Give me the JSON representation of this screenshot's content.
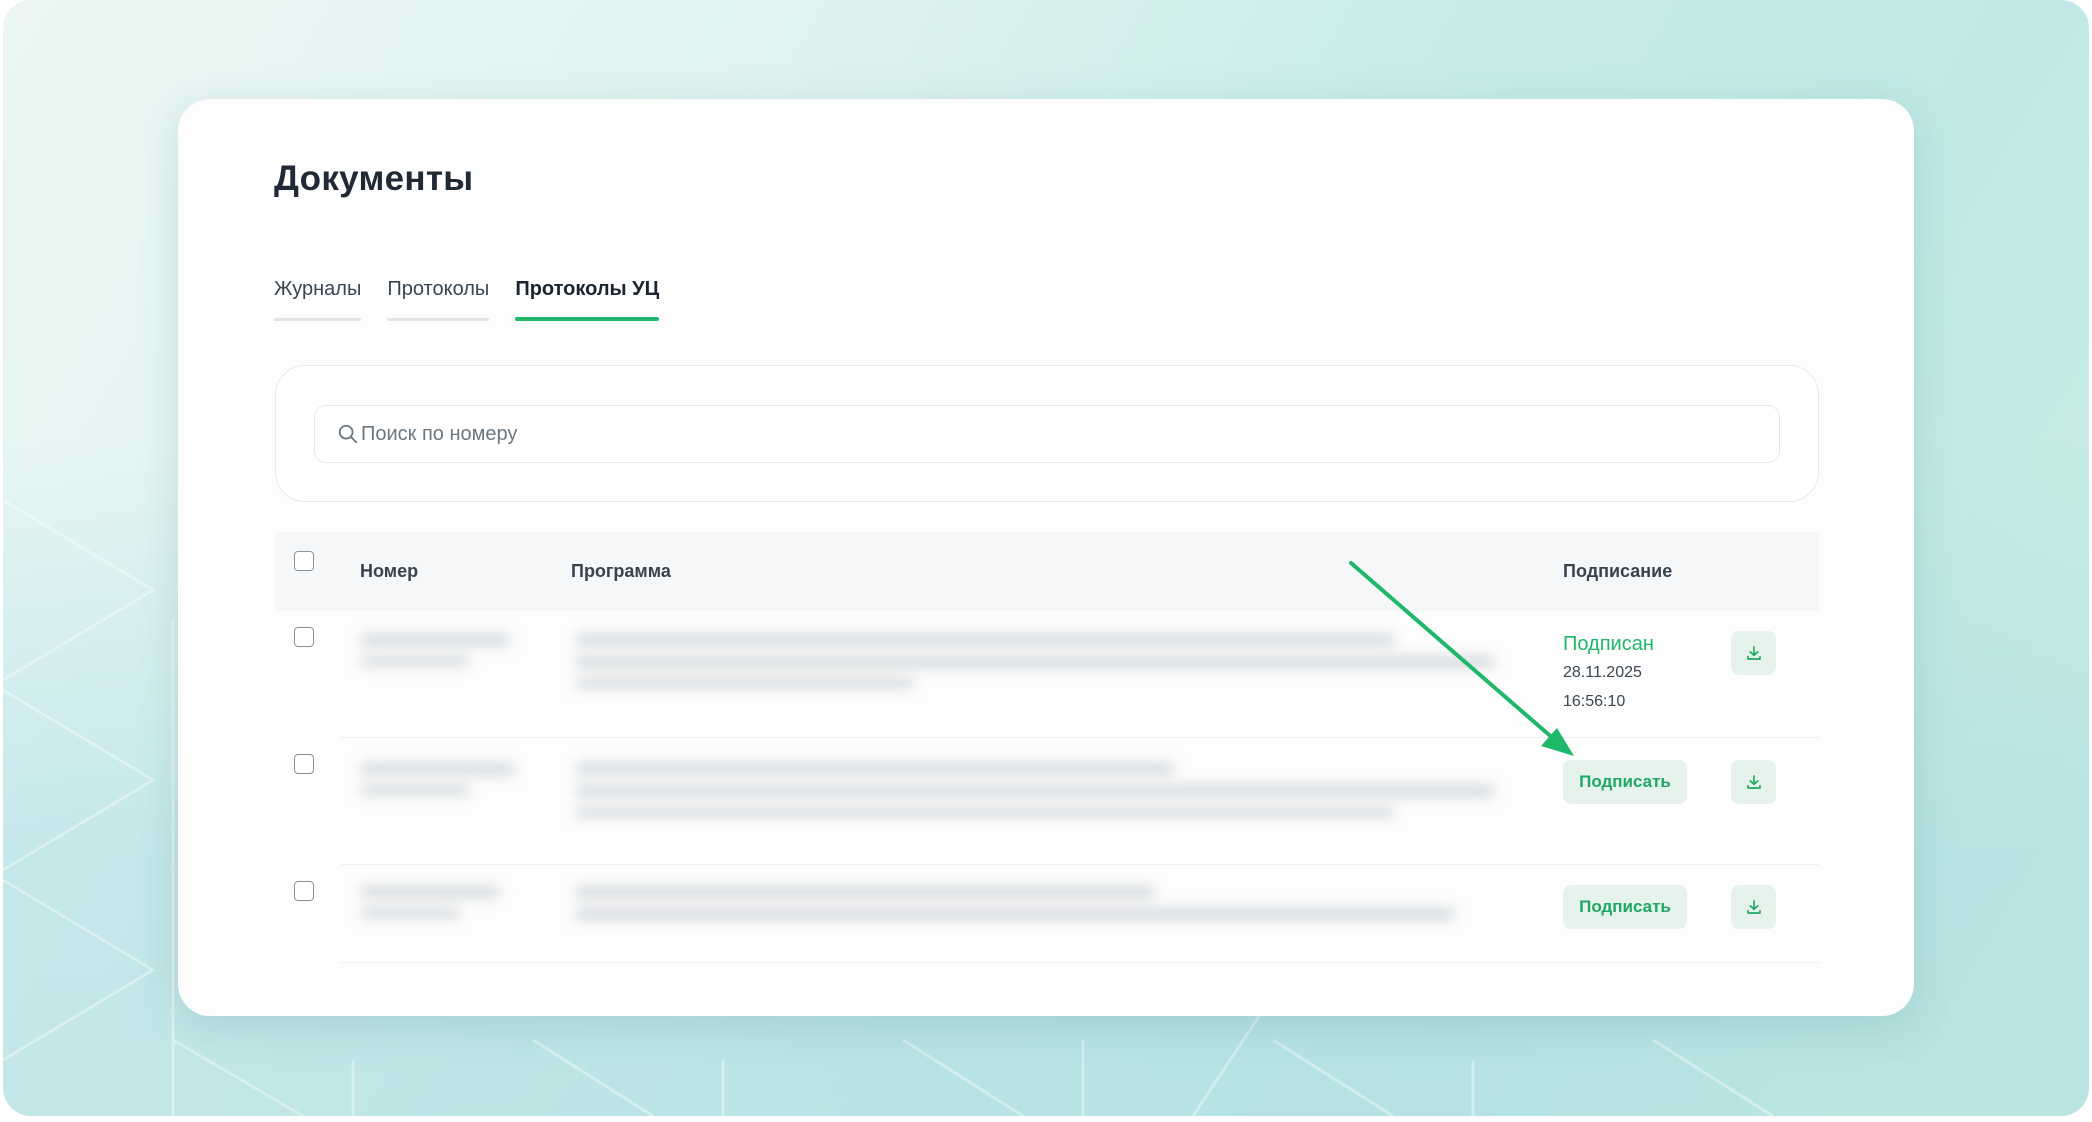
{
  "page_title": "Документы",
  "tabs": [
    {
      "label": "Журналы",
      "active": false
    },
    {
      "label": "Протоколы",
      "active": false
    },
    {
      "label": "Протоколы УЦ",
      "active": true
    }
  ],
  "search": {
    "placeholder": "Поиск по номеру",
    "value": ""
  },
  "table": {
    "columns": {
      "number": "Номер",
      "program": "Программа",
      "signing": "Подписание"
    },
    "rows": [
      {
        "status": "Подписан",
        "date": "28.11.2025",
        "time": "16:56:10"
      },
      {
        "action_label": "Подписать"
      },
      {
        "action_label": "Подписать"
      }
    ]
  },
  "colors": {
    "accent": "#1fb86b",
    "button_bg": "#e6f3ed",
    "title": "#1f2a36"
  },
  "icons": [
    "search-icon",
    "download-icon",
    "annotation-arrow"
  ]
}
